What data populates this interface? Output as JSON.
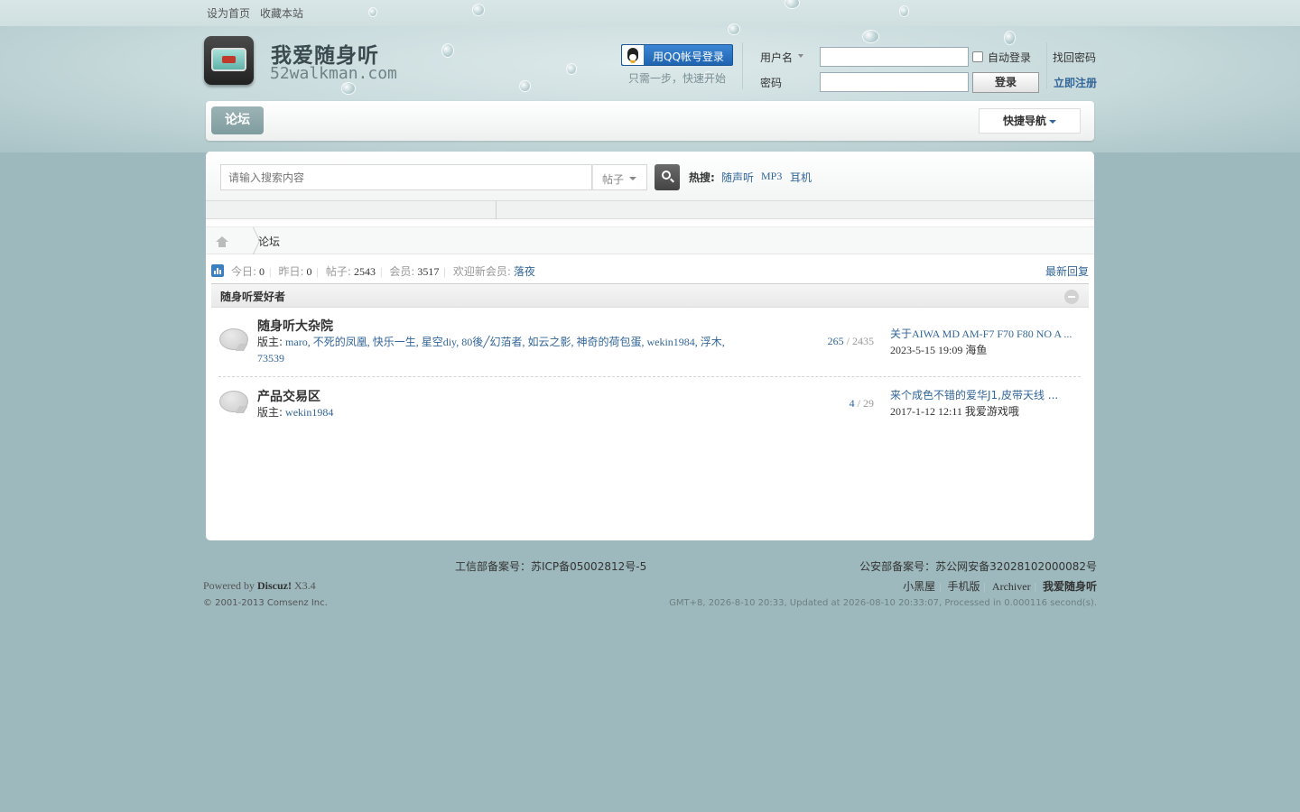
{
  "topbar": {
    "set_home": "设为首页",
    "bookmark": "收藏本站"
  },
  "logo": {
    "title": "我爱随身听",
    "subtitle": "52walkman.com"
  },
  "qq_login": {
    "button": "用QQ帐号登录",
    "hint": "只需一步，快速开始"
  },
  "login": {
    "username_label": "用户名",
    "password_label": "密码",
    "auto_login": "自动登录",
    "forgot_password": "找回密码",
    "submit": "登录",
    "register": "立即注册"
  },
  "nav": {
    "forum_tab": "论坛",
    "quick_nav": "快捷导航"
  },
  "search": {
    "placeholder": "请输入搜索内容",
    "type": "帖子",
    "hot_label": "热搜:",
    "hot_terms": [
      "随声听",
      "MP3",
      "耳机"
    ]
  },
  "breadcrumb": {
    "current": "论坛"
  },
  "stats": {
    "today_label": "今日:",
    "today": "0",
    "yesterday_label": "昨日:",
    "yesterday": "0",
    "posts_label": "帖子:",
    "posts": "2543",
    "members_label": "会员:",
    "members": "3517",
    "newest_label": "欢迎新会员:",
    "newest_member": "落夜",
    "latest_reply": "最新回复"
  },
  "category": {
    "title": "随身听爱好者"
  },
  "forums": [
    {
      "name": "随身听大杂院",
      "moderator_label": "版主:",
      "moderators": "maro, 不死的凤凰, 快乐一生, 星空diy, 80後╱幻萡者, 如云之影, 神奇的荷包蛋, wekin1984, 浮木, 73539",
      "threads": "265",
      "posts": "2435",
      "last_title": "关于AIWA MD AM-F7 F70 F80 NO A ...",
      "last_time": "2023-5-15 19:09",
      "last_user": "海鱼"
    },
    {
      "name": "产品交易区",
      "moderator_label": "版主:",
      "moderators": "wekin1984",
      "threads": "4",
      "posts": "29",
      "last_title": "来个成色不错的爱华J1,皮带天线 ...",
      "last_time": "2017-1-12 12:11",
      "last_user": "我爱游戏哦"
    }
  ],
  "footer": {
    "icp": "工信部备案号：苏ICP备05002812号-5",
    "police": "公安部备案号：苏公网安备32028102000082号",
    "powered_prefix": "Powered by",
    "powered_name": "Discuz!",
    "powered_version": "X3.4",
    "copyright": "© 2001-2013 Comsenz Inc.",
    "links": [
      "小黑屋",
      "手机版",
      "Archiver",
      "我爱随身听"
    ],
    "time_info": "GMT+8, 2026-8-10 20:33, Updated at 2026-08-10 20:33:07, Processed in 0.000116 second(s)."
  },
  "colors": {
    "background": "#9db9bd",
    "link": "#336699",
    "qq_button": "#1f64b0",
    "nav_tab": "#8fa9ac"
  }
}
